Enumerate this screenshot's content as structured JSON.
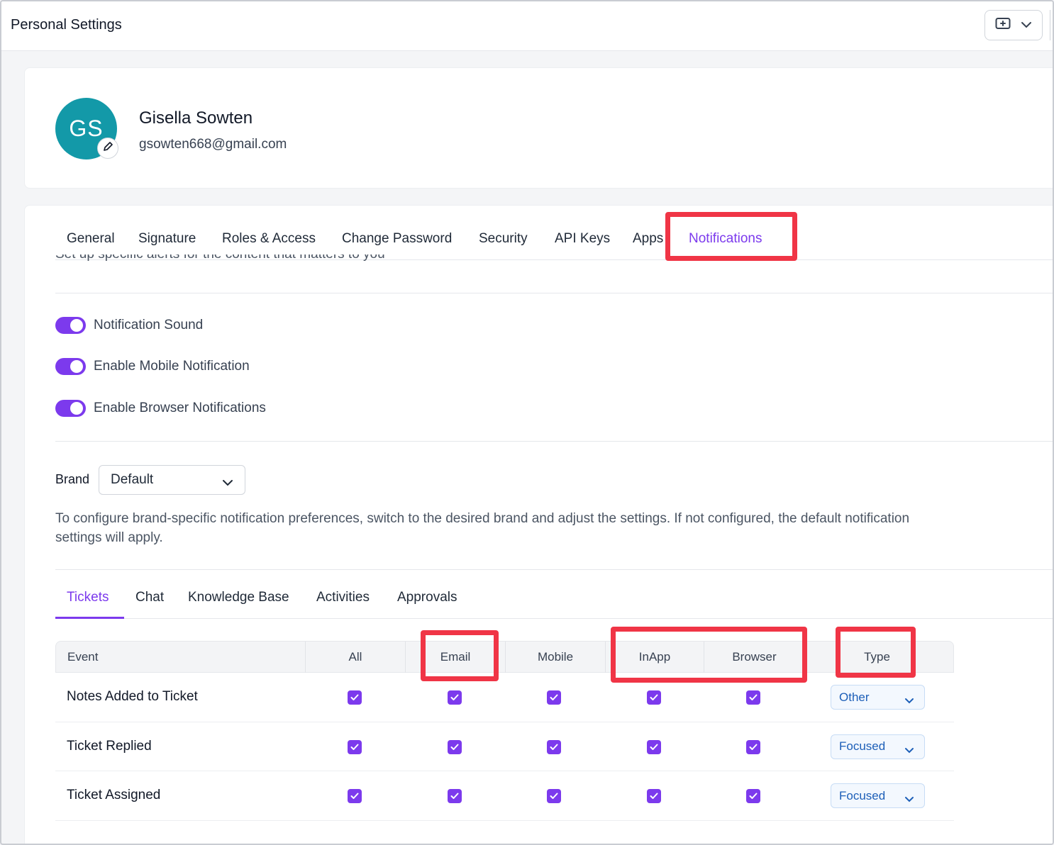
{
  "header": {
    "title": "Personal Settings",
    "ticket_icon": "ticket-icon",
    "dropdown_icon": "chevron-down-icon"
  },
  "profile": {
    "initials": "GS",
    "name": "Gisella Sowten",
    "email": "gsowten668@gmail.com",
    "avatar_color": "#1399a8",
    "edit_icon": "pencil-icon"
  },
  "settings_tabs": [
    {
      "label": "General"
    },
    {
      "label": "Signature"
    },
    {
      "label": "Roles & Access"
    },
    {
      "label": "Change Password"
    },
    {
      "label": "Security"
    },
    {
      "label": "API Keys"
    },
    {
      "label": "Apps"
    },
    {
      "label": "Notifications",
      "active": true
    }
  ],
  "notifications": {
    "subtitle": "Set up specific alerts for the content that matters to you",
    "toggles": [
      {
        "label": "Notification Sound",
        "on": true
      },
      {
        "label": "Enable Mobile Notification",
        "on": true
      },
      {
        "label": "Enable Browser Notifications",
        "on": true
      }
    ],
    "brand": {
      "label": "Brand",
      "selected": "Default",
      "note": "To configure brand-specific notification preferences, switch to the desired brand and adjust the settings. If not configured, the default notification settings will apply."
    },
    "category_tabs": [
      {
        "label": "Tickets",
        "active": true
      },
      {
        "label": "Chat"
      },
      {
        "label": "Knowledge Base"
      },
      {
        "label": "Activities"
      },
      {
        "label": "Approvals"
      }
    ],
    "table": {
      "columns": [
        "Event",
        "All",
        "Email",
        "Mobile",
        "InApp",
        "Browser",
        "Type"
      ],
      "rows": [
        {
          "event": "Notes Added to Ticket",
          "all": true,
          "email": true,
          "mobile": true,
          "inapp": true,
          "browser": true,
          "type": "Other"
        },
        {
          "event": "Ticket Replied",
          "all": true,
          "email": true,
          "mobile": true,
          "inapp": true,
          "browser": true,
          "type": "Focused"
        },
        {
          "event": "Ticket Assigned",
          "all": true,
          "email": true,
          "mobile": true,
          "inapp": true,
          "browser": true,
          "type": "Focused"
        }
      ]
    }
  },
  "colors": {
    "accent": "#7c3aed",
    "highlight": "#f03546",
    "type_text": "#1d5fb8"
  }
}
